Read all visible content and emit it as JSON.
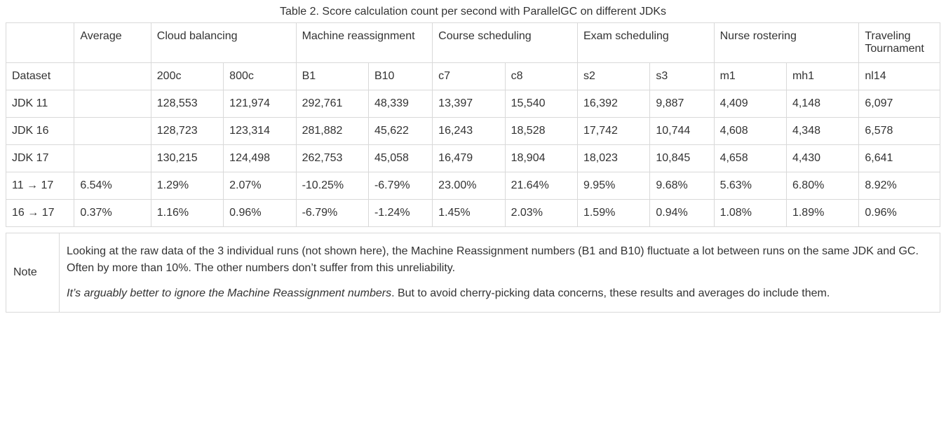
{
  "caption": "Table 2. Score calculation count per second with ParallelGC on different JDKs",
  "header_groups": {
    "average": "Average",
    "cloud": "Cloud balancing",
    "machine": "Machine reassignment",
    "course": "Course scheduling",
    "exam": "Exam scheduling",
    "nurse": "Nurse rostering",
    "travel": "Traveling Tournament"
  },
  "dataset_row": {
    "label": "Dataset",
    "cols": [
      "200c",
      "800c",
      "B1",
      "B10",
      "c7",
      "c8",
      "s2",
      "s3",
      "m1",
      "mh1",
      "nl14"
    ]
  },
  "rows": [
    {
      "label": "JDK 11",
      "avg": "",
      "vals": [
        "128,553",
        "121,974",
        "292,761",
        "48,339",
        "13,397",
        "15,540",
        "16,392",
        "9,887",
        "4,409",
        "4,148",
        "6,097"
      ]
    },
    {
      "label": "JDK 16",
      "avg": "",
      "vals": [
        "128,723",
        "123,314",
        "281,882",
        "45,622",
        "16,243",
        "18,528",
        "17,742",
        "10,744",
        "4,608",
        "4,348",
        "6,578"
      ]
    },
    {
      "label": "JDK 17",
      "avg": "",
      "vals": [
        "130,215",
        "124,498",
        "262,753",
        "45,058",
        "16,479",
        "18,904",
        "18,023",
        "10,845",
        "4,658",
        "4,430",
        "6,641"
      ]
    },
    {
      "label": "11 → 17",
      "avg": "6.54%",
      "vals": [
        "1.29%",
        "2.07%",
        "-10.25%",
        "-6.79%",
        "23.00%",
        "21.64%",
        "9.95%",
        "9.68%",
        "5.63%",
        "6.80%",
        "8.92%"
      ]
    },
    {
      "label": "16 → 17",
      "avg": "0.37%",
      "vals": [
        "1.16%",
        "0.96%",
        "-6.79%",
        "-1.24%",
        "1.45%",
        "2.03%",
        "1.59%",
        "0.94%",
        "1.08%",
        "1.89%",
        "0.96%"
      ]
    }
  ],
  "note": {
    "label": "Note",
    "p1": "Looking at the raw data of the 3 individual runs (not shown here), the Machine Reassignment numbers (B1 and B10) fluctuate a lot between runs on the same JDK and GC. Often by more than 10%. The other numbers don’t suffer from this unreliability.",
    "p2_em": "It’s arguably better to ignore the Machine Reassignment numbers",
    "p2_rest": ". But to avoid cherry-picking data concerns, these results and averages do include them."
  }
}
